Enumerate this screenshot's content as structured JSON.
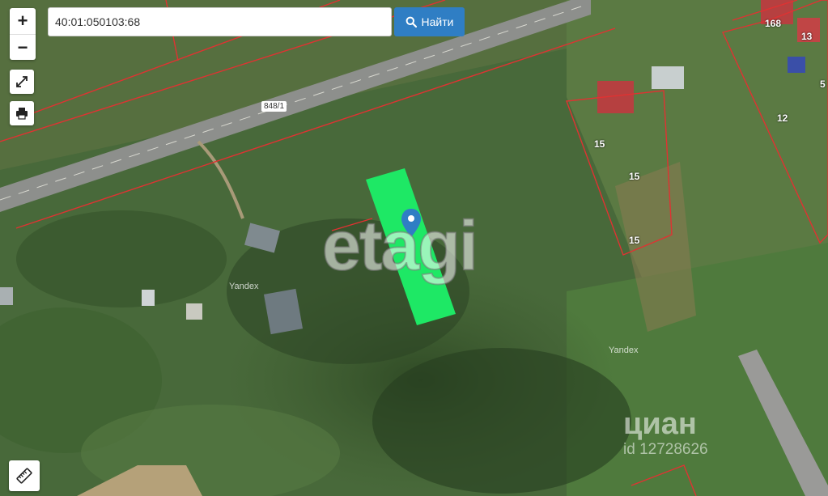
{
  "search": {
    "value": "40:01:050103:68",
    "button_label": "Найти"
  },
  "zoom": {
    "in_label": "+",
    "out_label": "−"
  },
  "watermarks": {
    "etagi": "etagi",
    "cian_name": "циан",
    "cian_id": "id 12728626"
  },
  "map_labels": {
    "road": "848/1",
    "yandex_1": "Yandex",
    "yandex_2": "Yandex",
    "lot_15a": "15",
    "lot_15b": "15",
    "lot_15c": "15",
    "lot_12": "12",
    "lot_168": "168",
    "lot_13": "13",
    "lot_5": "5"
  },
  "colors": {
    "parcel": "#1ee865",
    "button": "#2f7ec4",
    "marker": "#2f7ec4",
    "boundary": "#e03232"
  },
  "icons": [
    "search-icon",
    "fullscreen-icon",
    "print-icon",
    "ruler-icon",
    "location-pin-icon"
  ]
}
